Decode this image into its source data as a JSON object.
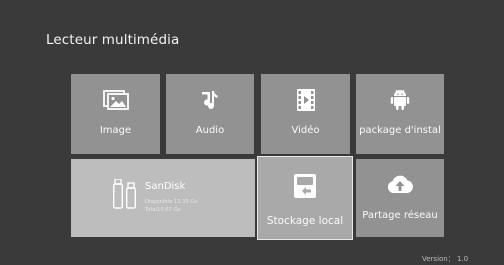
{
  "header": {
    "title": "Lecteur multimédia"
  },
  "tiles": [
    {
      "label": "Image",
      "icon": "image-icon"
    },
    {
      "label": "Audio",
      "icon": "music-icon"
    },
    {
      "label": "Vidéo",
      "icon": "video-icon"
    },
    {
      "label": "package d'instal",
      "icon": "android-icon"
    }
  ],
  "storage": {
    "device": {
      "name": "SanDisk",
      "free": "Disponible 13.35 Go",
      "total": "Total15.67 Go",
      "icon": "usb-drive-icon"
    },
    "local": {
      "label": "Stockage local",
      "icon": "local-storage-icon"
    },
    "network": {
      "label": "Partage réseau",
      "icon": "cloud-upload-icon"
    }
  },
  "footer": {
    "version": "Version： 1.0"
  },
  "colors": {
    "background": "#3a3a3a",
    "tile": "#929292",
    "tile_light": "#bdbdbd",
    "tile_focused": "#a9a9a9",
    "focus_border": "#e8e8e8"
  }
}
